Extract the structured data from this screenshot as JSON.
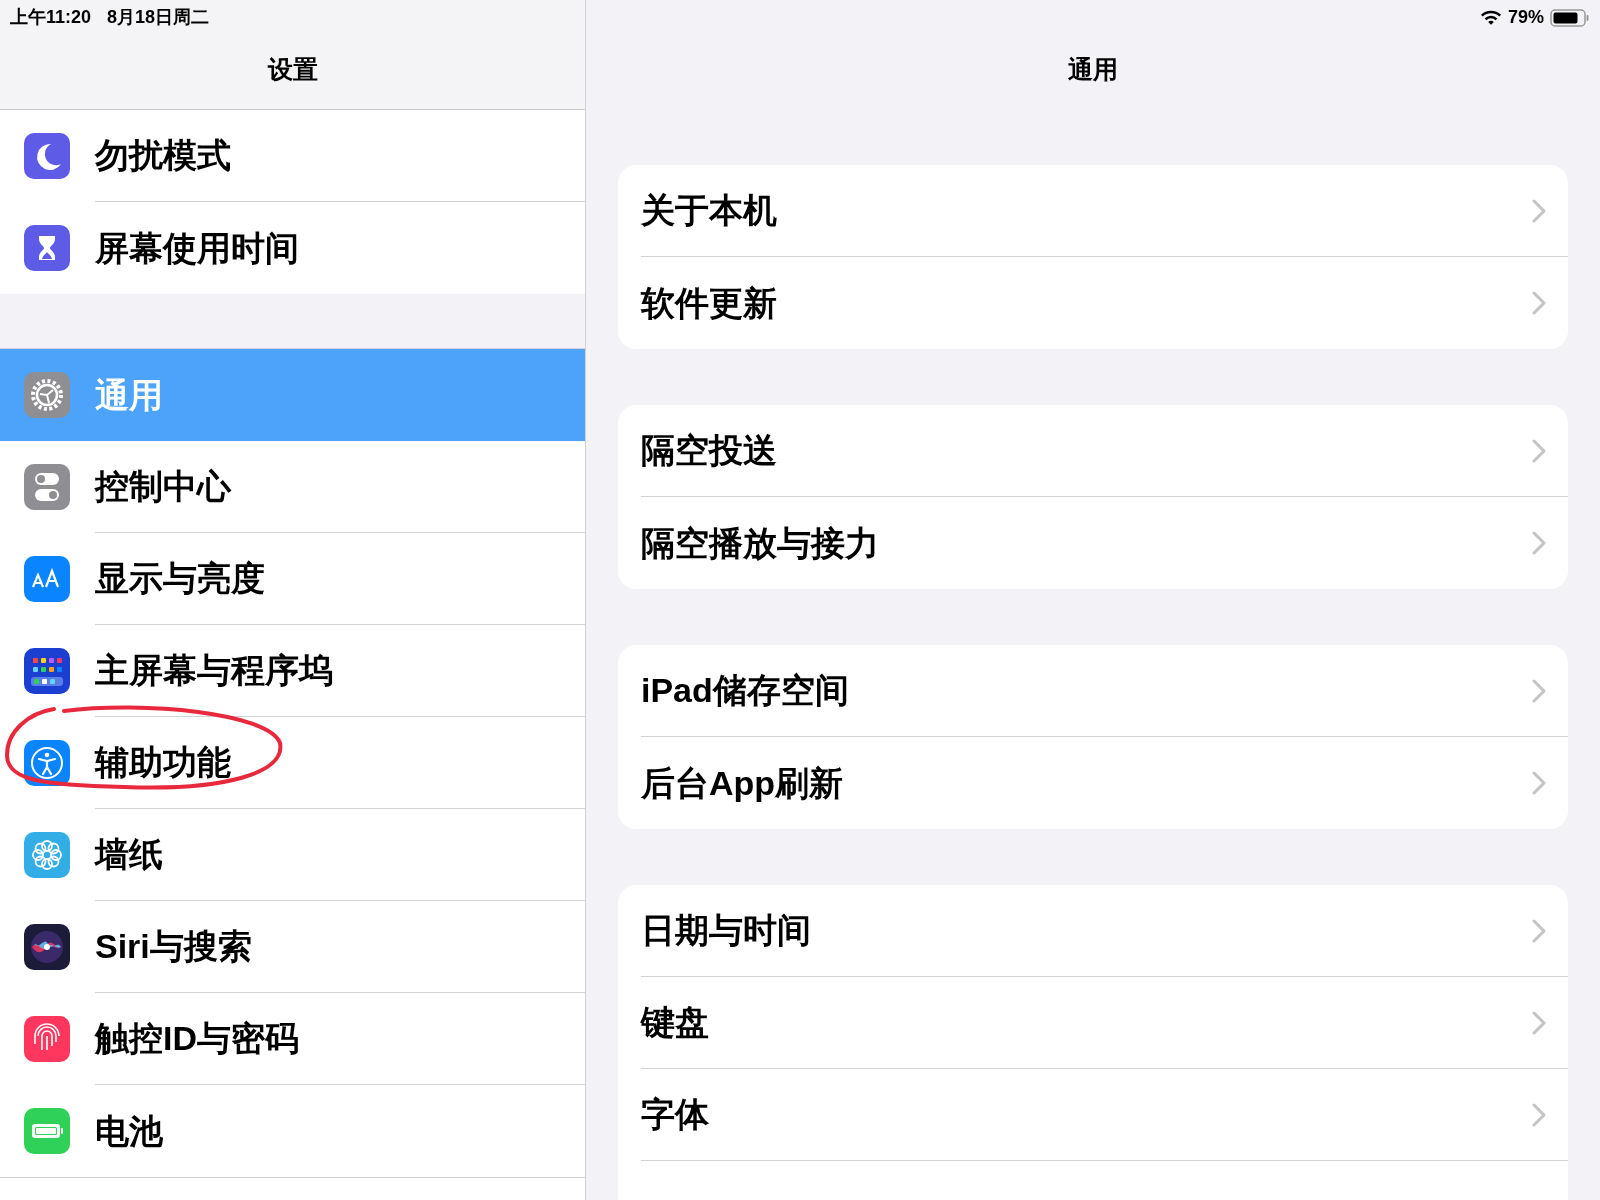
{
  "status_bar": {
    "time": "上午11:20",
    "date": "8月18日周二",
    "battery": "79%"
  },
  "sidebar": {
    "title": "设置",
    "groups": [
      {
        "items": [
          {
            "label": "勿扰模式",
            "selected": false,
            "circled": false
          },
          {
            "label": "屏幕使用时间",
            "selected": false,
            "circled": false
          }
        ]
      },
      {
        "items": [
          {
            "label": "通用",
            "selected": true,
            "circled": false
          },
          {
            "label": "控制中心",
            "selected": false,
            "circled": false
          },
          {
            "label": "显示与亮度",
            "selected": false,
            "circled": false
          },
          {
            "label": "主屏幕与程序坞",
            "selected": false,
            "circled": false
          },
          {
            "label": "辅助功能",
            "selected": false,
            "circled": true
          },
          {
            "label": "墙纸",
            "selected": false,
            "circled": false
          },
          {
            "label": "Siri与搜索",
            "selected": false,
            "circled": false
          },
          {
            "label": "触控ID与密码",
            "selected": false,
            "circled": false
          },
          {
            "label": "电池",
            "selected": false,
            "circled": false
          }
        ]
      }
    ]
  },
  "detail": {
    "title": "通用",
    "groups": [
      {
        "items": [
          "关于本机",
          "软件更新"
        ]
      },
      {
        "items": [
          "隔空投送",
          "隔空播放与接力"
        ]
      },
      {
        "items": [
          "iPad储存空间",
          "后台App刷新"
        ]
      },
      {
        "items": [
          "日期与时间",
          "键盘",
          "字体"
        ]
      }
    ]
  }
}
